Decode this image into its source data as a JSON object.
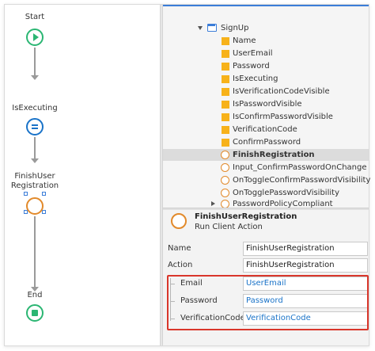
{
  "flow": {
    "start_label": "Start",
    "assign_label": "IsExecuting",
    "action_label_line1": "FinishUser",
    "action_label_line2": "Registration",
    "end_label": "End"
  },
  "tree": {
    "root": "SignUp",
    "items": [
      {
        "label": "Name",
        "kind": "variable"
      },
      {
        "label": "UserEmail",
        "kind": "variable"
      },
      {
        "label": "Password",
        "kind": "variable"
      },
      {
        "label": "IsExecuting",
        "kind": "variable"
      },
      {
        "label": "IsVerificationCodeVisible",
        "kind": "variable"
      },
      {
        "label": "IsPasswordVisible",
        "kind": "variable"
      },
      {
        "label": "IsConfirmPasswordVisible",
        "kind": "variable"
      },
      {
        "label": "VerificationCode",
        "kind": "variable"
      },
      {
        "label": "ConfirmPassword",
        "kind": "variable"
      },
      {
        "label": "FinishRegistration",
        "kind": "action",
        "selected": true
      },
      {
        "label": "Input_ConfirmPasswordOnChange",
        "kind": "action"
      },
      {
        "label": "OnToggleConfirmPasswordVisibility",
        "kind": "action"
      },
      {
        "label": "OnTogglePasswordVisibility",
        "kind": "action"
      },
      {
        "label": "PasswordPolicyCompliant",
        "kind": "structure",
        "collapsed": true
      }
    ]
  },
  "properties": {
    "title": "FinishUserRegistration",
    "subtitle": "Run Client Action",
    "name_label": "Name",
    "name_value": "FinishUserRegistration",
    "action_label": "Action",
    "action_value": "FinishUserRegistration",
    "params": [
      {
        "label": "Email",
        "value": "UserEmail"
      },
      {
        "label": "Password",
        "value": "Password"
      },
      {
        "label": "VerificationCode",
        "value": "VerificationCode"
      }
    ]
  },
  "colors": {
    "start_end": "#2bb673",
    "assign": "#1a73c8",
    "action": "#e28a2b",
    "variable": "#f7b21a",
    "highlight": "#d9362b"
  },
  "icons": [
    "play-icon",
    "assign-icon",
    "client-action-icon",
    "stop-icon",
    "screen-icon",
    "variable-icon",
    "action-icon",
    "structure-icon",
    "caret-down-icon",
    "caret-right-icon"
  ]
}
